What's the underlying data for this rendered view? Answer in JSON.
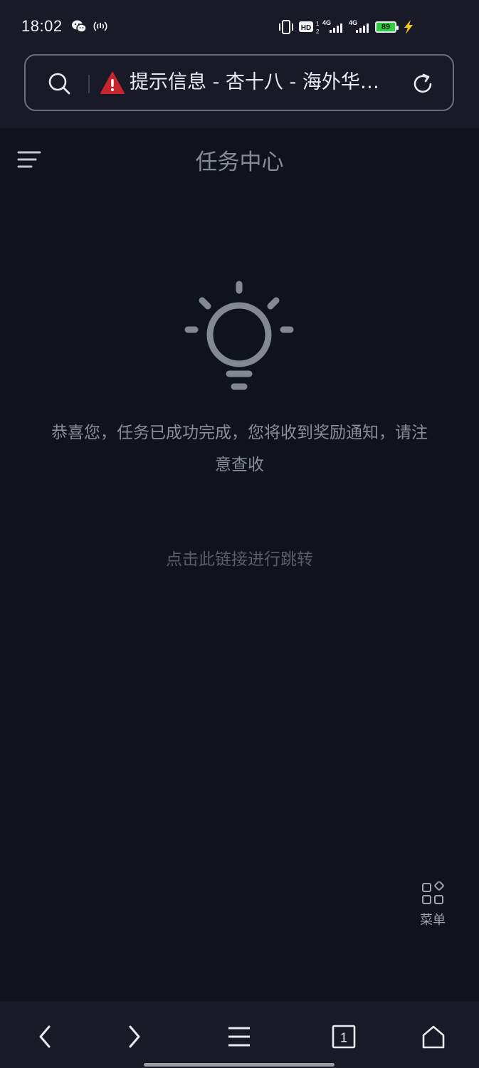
{
  "status_bar": {
    "time": "18:02",
    "battery_level": "89",
    "icons": [
      "wechat-icon",
      "hotspot-icon",
      "vibrate-icon",
      "hd-icon",
      "signal-4g-icon",
      "signal-4g-icon",
      "battery-icon",
      "charging-icon"
    ]
  },
  "address_bar": {
    "page_title": "提示信息 - 杏十八 - 海外华…",
    "warning_color": "#c8262e"
  },
  "page": {
    "header_title": "任务中心",
    "message": "恭喜您，任务已成功完成，您将收到奖励通知，请注意查收",
    "link_text": "点击此链接进行跳转"
  },
  "floating_menu": {
    "label": "菜单"
  },
  "bottom_nav": {
    "tab_count": "1"
  }
}
